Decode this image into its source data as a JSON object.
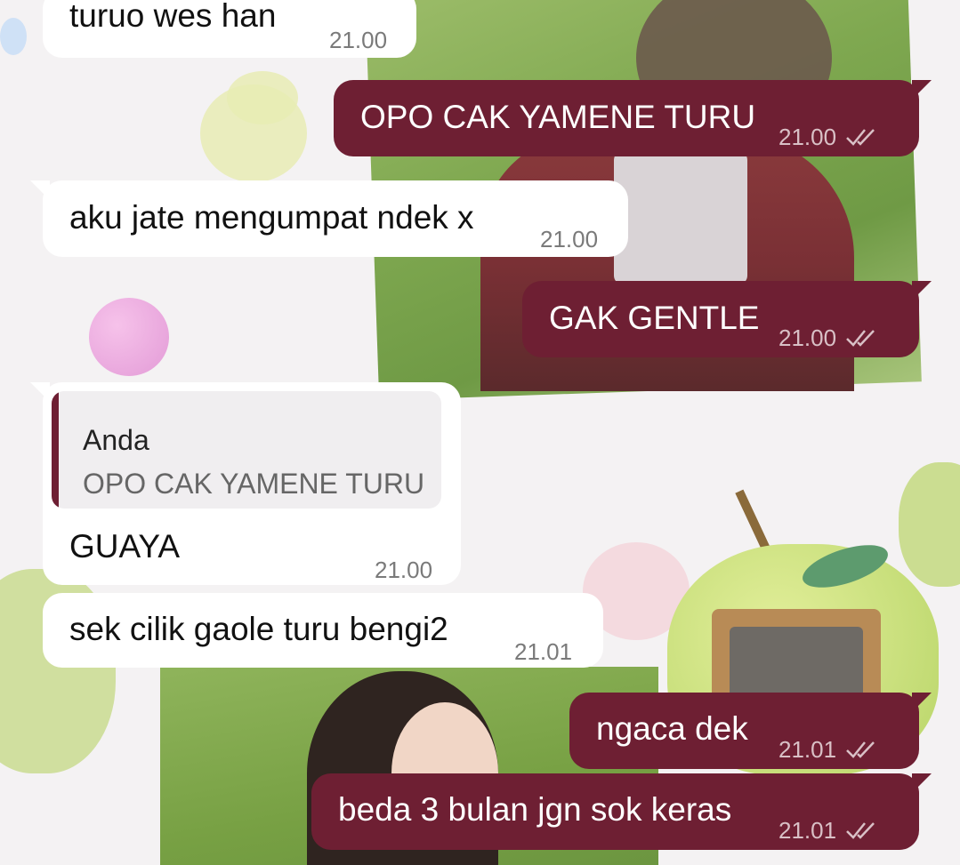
{
  "messages": [
    {
      "id": "m1",
      "direction": "incoming",
      "text": "turuo wes han",
      "time": "21.00"
    },
    {
      "id": "m2",
      "direction": "outgoing",
      "text": "OPO CAK YAMENE TURU",
      "time": "21.00",
      "status": "read"
    },
    {
      "id": "m3",
      "direction": "incoming",
      "text": "aku jate mengumpat ndek x",
      "time": "21.00"
    },
    {
      "id": "m4",
      "direction": "outgoing",
      "text": "GAK GENTLE",
      "time": "21.00",
      "status": "read"
    },
    {
      "id": "m5",
      "direction": "incoming",
      "reply_to": {
        "author": "Anda",
        "text": "OPO CAK YAMENE TURU"
      },
      "text": "GUAYA",
      "time": "21.00"
    },
    {
      "id": "m6",
      "direction": "incoming",
      "text": "sek cilik gaole turu bengi2",
      "time": "21.01"
    },
    {
      "id": "m7",
      "direction": "outgoing",
      "text": "ngaca dek",
      "time": "21.01",
      "status": "read"
    },
    {
      "id": "m8",
      "direction": "outgoing",
      "text": "beda 3 bulan jgn sok keras",
      "time": "21.01",
      "status": "read"
    }
  ],
  "colors": {
    "outgoing_bubble": "#6e1f33",
    "incoming_bubble": "#ffffff",
    "quote_accent": "#6e1f33"
  },
  "icons": {
    "read_receipt": "double-check-icon"
  }
}
